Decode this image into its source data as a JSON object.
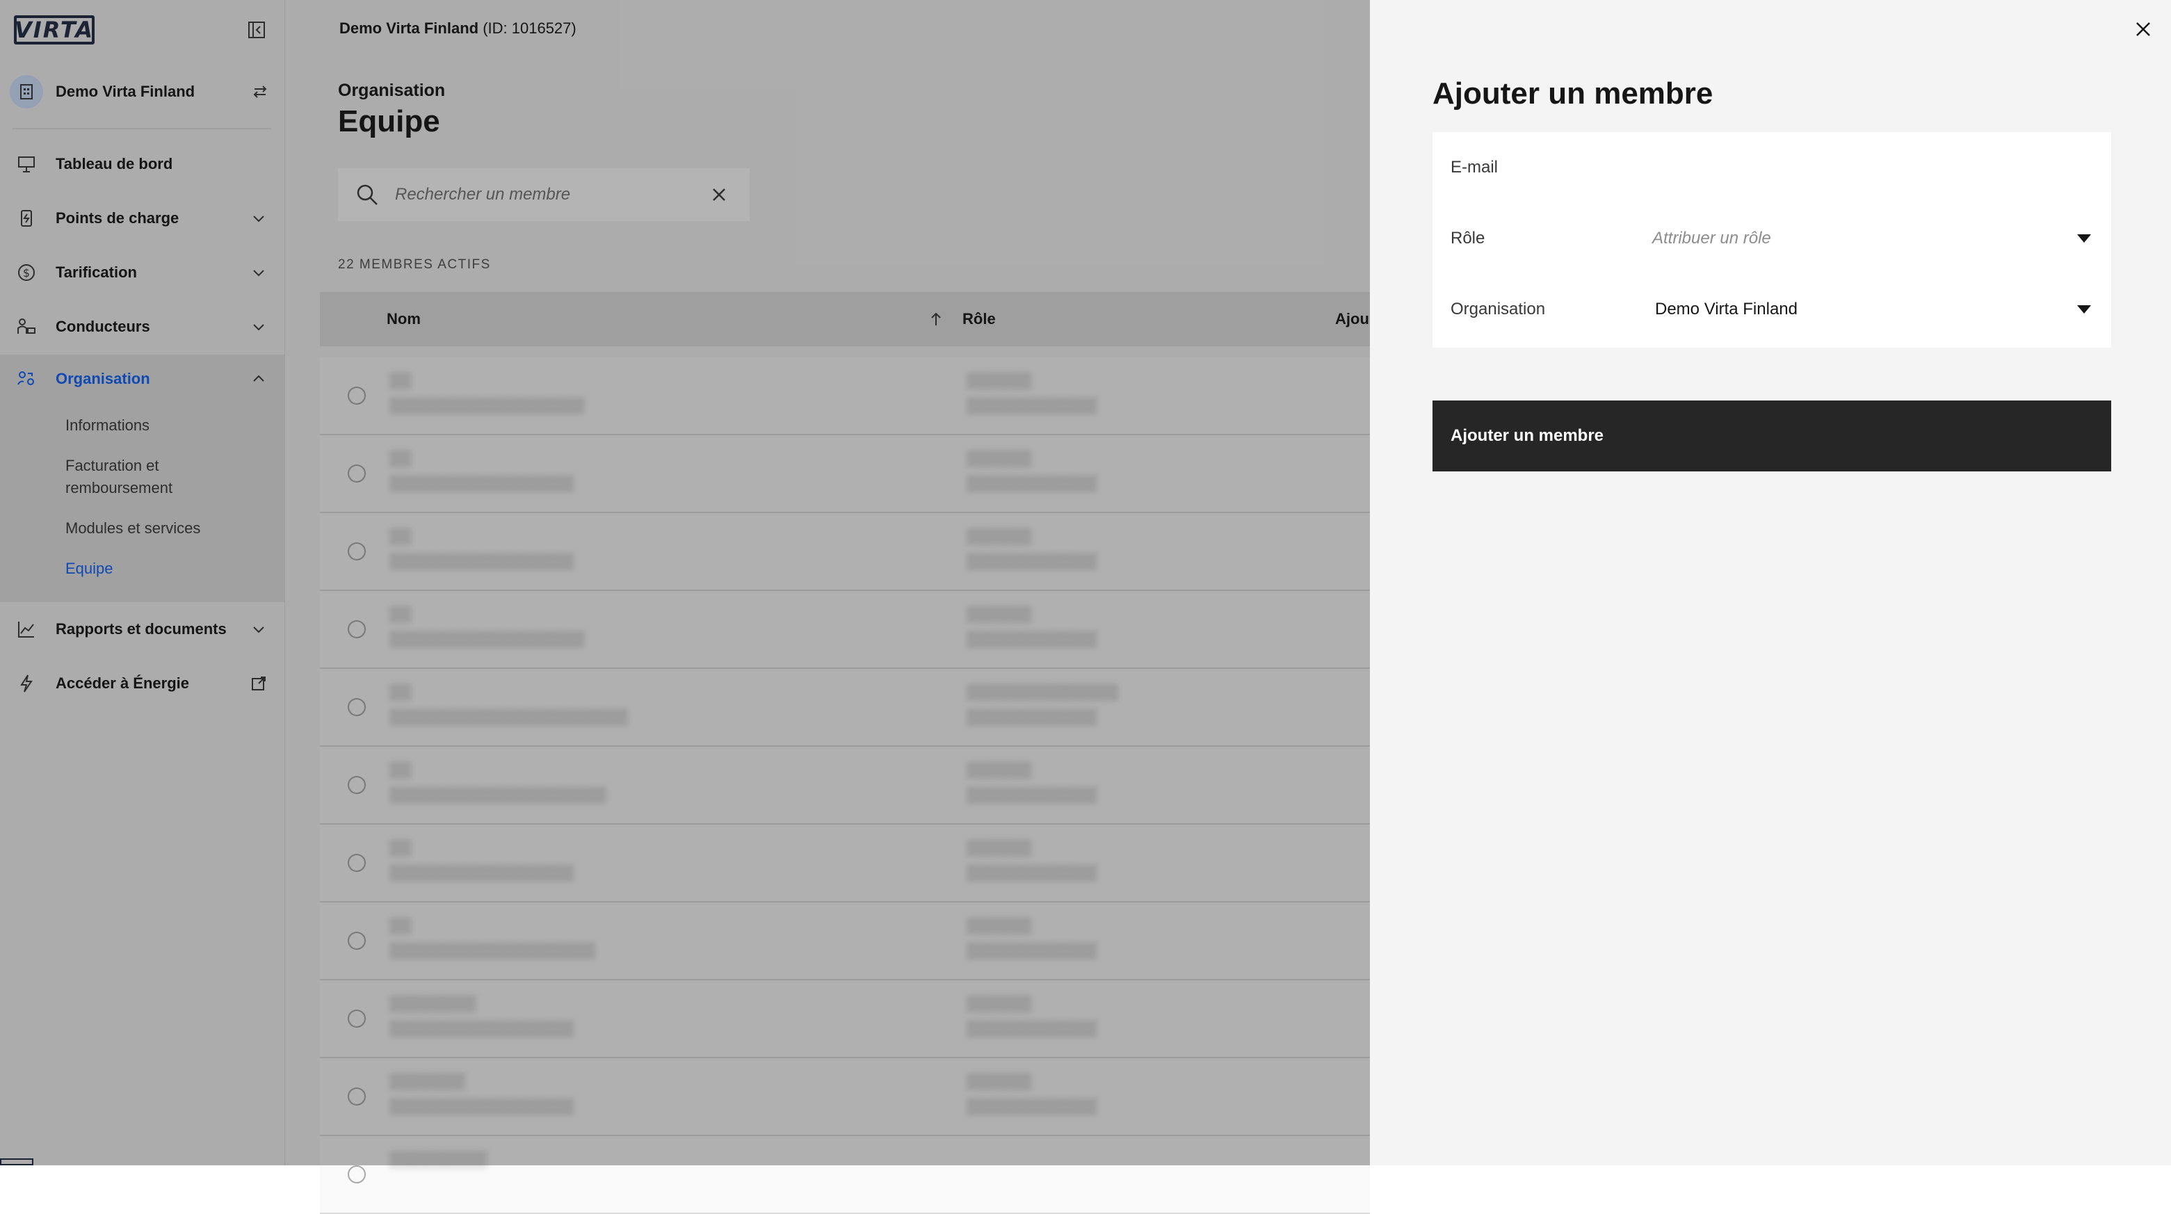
{
  "app": {
    "logo_text": "VIRTA"
  },
  "header": {
    "org_title": "Demo Virta Finland",
    "org_id": "(ID: 1016527)"
  },
  "sidebar": {
    "org_name": "Demo Virta Finland",
    "items": [
      {
        "label": "Tableau de bord",
        "icon": "dashboard-icon"
      },
      {
        "label": "Points de charge",
        "icon": "charger-icon"
      },
      {
        "label": "Tarification",
        "icon": "dollar-icon"
      },
      {
        "label": "Conducteurs",
        "icon": "driver-icon"
      },
      {
        "label": "Organisation",
        "icon": "organization-icon"
      },
      {
        "label": "Rapports et documents",
        "icon": "chart-icon"
      },
      {
        "label": "Accéder à Énergie",
        "icon": "bolt-icon"
      }
    ],
    "sub_items": [
      "Informations",
      "Facturation et",
      "remboursement",
      "Modules et services",
      "Equipe"
    ]
  },
  "main": {
    "breadcrumb": "Organisation",
    "title": "Equipe",
    "search_placeholder": "Rechercher un membre",
    "member_count": "22 MEMBRES ACTIFS",
    "columns": {
      "name": "Nom",
      "role": "Rôle",
      "added": "Ajou"
    }
  },
  "panel": {
    "title": "Ajouter un membre",
    "email_label": "E-mail",
    "role_label": "Rôle",
    "role_placeholder": "Attribuer un rôle",
    "org_label": "Organisation",
    "org_value": "Demo Virta Finland",
    "submit_label": "Ajouter un membre"
  },
  "colors": {
    "accent": "#0f62fe",
    "submit_bg": "#262626",
    "panel_bg": "#f4f4f4"
  }
}
